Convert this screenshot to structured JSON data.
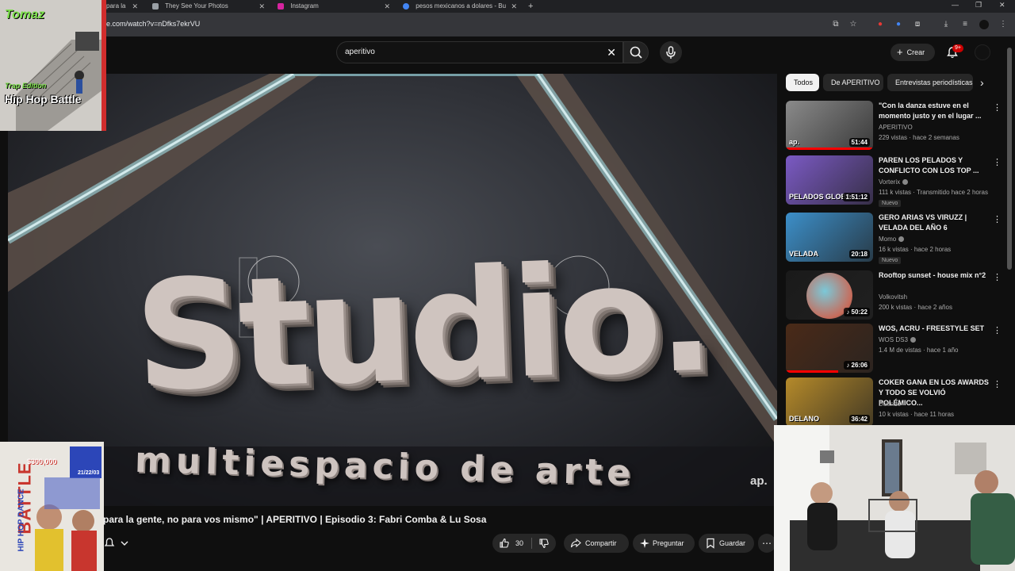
{
  "browser": {
    "tabs": [
      {
        "label": "para la"
      },
      {
        "label": "They See Your Photos"
      },
      {
        "label": "Instagram"
      },
      {
        "label": "pesos mexicanos a dolares - Bu"
      }
    ],
    "url": "e.com/watch?v=nDfks7ekrVU"
  },
  "header": {
    "search_value": "aperitivo",
    "create_label": "Crear",
    "notif_badge": "9+"
  },
  "player": {
    "brand_main": "Studio.",
    "brand_sub": "multiespacio de arte",
    "watermark": "ap."
  },
  "video": {
    "title": "para la gente, no para vos mismo\" | APERITIVO | Episodio 3: Fabri Comba & Lu Sosa",
    "likes": "30",
    "share_label": "Compartir",
    "ask_label": "Preguntar",
    "save_label": "Guardar"
  },
  "sidebar": {
    "chips": [
      "Todos",
      "De APERITIVO",
      "Entrevistas periodísticas"
    ],
    "recommendations": [
      {
        "title": "\"Con la danza estuve en el momento justo y en el lugar ...",
        "channel": "APERITIVO",
        "verified": false,
        "meta": "229 vistas · hace 2 semanas",
        "duration": "51:44",
        "is_new": false,
        "watched": 1.0,
        "thumb_color": "#8a8a8a"
      },
      {
        "title": "PAREN LOS PELADOS Y CONFLICTO CON LOS TOP ...",
        "channel": "Vorterix",
        "verified": true,
        "meta": "111 k vistas · Transmitido hace 2 horas",
        "duration": "1:51:12",
        "is_new": true,
        "new_label": "Nuevo",
        "watched": 0,
        "thumb_color": "#7b5ac4"
      },
      {
        "title": "GERO ARIAS VS VIRUZZ | VELADA DEL AÑO 6",
        "channel": "Momo",
        "verified": true,
        "meta": "16 k vistas · hace 2 horas",
        "duration": "20:18",
        "is_new": true,
        "new_label": "Nuevo",
        "watched": 0,
        "thumb_color": "#3c8fc9"
      },
      {
        "title": "Rooftop sunset - house mix n°2",
        "channel": "Volkovitsh",
        "verified": false,
        "meta": "200 k vistas · hace 2 años",
        "duration": "50:22",
        "is_new": false,
        "watched": 0,
        "thumb_color": "#1a1a1a"
      },
      {
        "title": "WOS, ACRU - FREESTYLE SET",
        "channel": "WOS DS3",
        "verified": true,
        "meta": "1.4 M de vistas · hace 1 año",
        "duration": "26:06",
        "is_new": false,
        "watched": 0.6,
        "thumb_color": "#4a2a18"
      },
      {
        "title": "COKER GANA EN LOS AWARDS Y TODO SE VOLVIÓ POLÉMICO...",
        "channel": "Duende",
        "verified": false,
        "meta": "10 k vistas · hace 11 horas",
        "duration": "36:42",
        "is_new": false,
        "watched": 0,
        "thumb_color": "#b58a2a"
      }
    ]
  },
  "overlays": {
    "top_left_poster": {
      "line1": "Tomaz",
      "line2": "Trap Edition",
      "line3": "Hip Hop Battle"
    },
    "bottom_left_poster": {
      "heading": "BATTLE",
      "sub": "HIP HOP DANCE",
      "prize": "$300,000",
      "date": "21/22/03"
    },
    "thumb_labels": {
      "ap": "ap.",
      "pelados": "PELADOS GLOBAL",
      "velada": "VELADA",
      "delano": "DELANO"
    }
  }
}
